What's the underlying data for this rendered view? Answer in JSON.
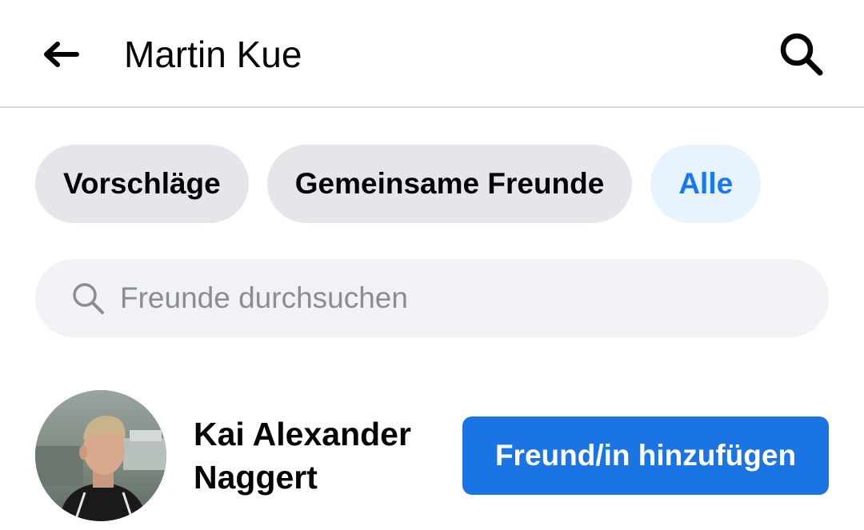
{
  "header": {
    "title": "Martin Kue",
    "back_icon": "arrow-left-icon",
    "search_icon": "search-icon"
  },
  "filters": {
    "chips": [
      {
        "label": "Vorschläge",
        "active": false
      },
      {
        "label": "Gemeinsame Freunde",
        "active": false
      },
      {
        "label": "Alle",
        "active": true
      }
    ]
  },
  "search": {
    "placeholder": "Freunde durchsuchen",
    "value": "",
    "icon": "search-icon"
  },
  "friends": [
    {
      "name": "Kai Alexander Naggert",
      "action_label": "Freund/in hinzufügen"
    }
  ],
  "colors": {
    "accent": "#1877f2",
    "button_bg": "#1b74e4",
    "chip_bg": "#e4e6eb",
    "chip_active_bg": "#e7f3ff",
    "search_bg": "#f0f2f5"
  }
}
